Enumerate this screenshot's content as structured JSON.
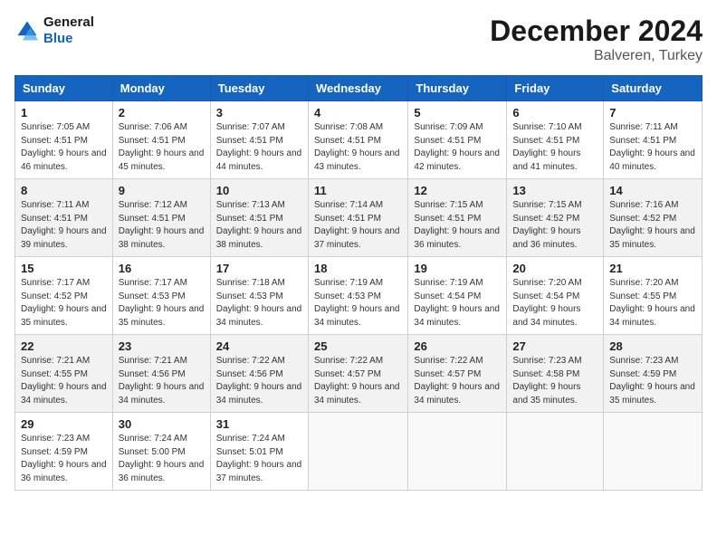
{
  "logo": {
    "line1": "General",
    "line2": "Blue"
  },
  "title": "December 2024",
  "location": "Balveren, Turkey",
  "headers": [
    "Sunday",
    "Monday",
    "Tuesday",
    "Wednesday",
    "Thursday",
    "Friday",
    "Saturday"
  ],
  "weeks": [
    [
      {
        "day": "1",
        "sunrise": "7:05 AM",
        "sunset": "4:51 PM",
        "daylight": "9 hours and 46 minutes."
      },
      {
        "day": "2",
        "sunrise": "7:06 AM",
        "sunset": "4:51 PM",
        "daylight": "9 hours and 45 minutes."
      },
      {
        "day": "3",
        "sunrise": "7:07 AM",
        "sunset": "4:51 PM",
        "daylight": "9 hours and 44 minutes."
      },
      {
        "day": "4",
        "sunrise": "7:08 AM",
        "sunset": "4:51 PM",
        "daylight": "9 hours and 43 minutes."
      },
      {
        "day": "5",
        "sunrise": "7:09 AM",
        "sunset": "4:51 PM",
        "daylight": "9 hours and 42 minutes."
      },
      {
        "day": "6",
        "sunrise": "7:10 AM",
        "sunset": "4:51 PM",
        "daylight": "9 hours and 41 minutes."
      },
      {
        "day": "7",
        "sunrise": "7:11 AM",
        "sunset": "4:51 PM",
        "daylight": "9 hours and 40 minutes."
      }
    ],
    [
      {
        "day": "8",
        "sunrise": "7:11 AM",
        "sunset": "4:51 PM",
        "daylight": "9 hours and 39 minutes."
      },
      {
        "day": "9",
        "sunrise": "7:12 AM",
        "sunset": "4:51 PM",
        "daylight": "9 hours and 38 minutes."
      },
      {
        "day": "10",
        "sunrise": "7:13 AM",
        "sunset": "4:51 PM",
        "daylight": "9 hours and 38 minutes."
      },
      {
        "day": "11",
        "sunrise": "7:14 AM",
        "sunset": "4:51 PM",
        "daylight": "9 hours and 37 minutes."
      },
      {
        "day": "12",
        "sunrise": "7:15 AM",
        "sunset": "4:51 PM",
        "daylight": "9 hours and 36 minutes."
      },
      {
        "day": "13",
        "sunrise": "7:15 AM",
        "sunset": "4:52 PM",
        "daylight": "9 hours and 36 minutes."
      },
      {
        "day": "14",
        "sunrise": "7:16 AM",
        "sunset": "4:52 PM",
        "daylight": "9 hours and 35 minutes."
      }
    ],
    [
      {
        "day": "15",
        "sunrise": "7:17 AM",
        "sunset": "4:52 PM",
        "daylight": "9 hours and 35 minutes."
      },
      {
        "day": "16",
        "sunrise": "7:17 AM",
        "sunset": "4:53 PM",
        "daylight": "9 hours and 35 minutes."
      },
      {
        "day": "17",
        "sunrise": "7:18 AM",
        "sunset": "4:53 PM",
        "daylight": "9 hours and 34 minutes."
      },
      {
        "day": "18",
        "sunrise": "7:19 AM",
        "sunset": "4:53 PM",
        "daylight": "9 hours and 34 minutes."
      },
      {
        "day": "19",
        "sunrise": "7:19 AM",
        "sunset": "4:54 PM",
        "daylight": "9 hours and 34 minutes."
      },
      {
        "day": "20",
        "sunrise": "7:20 AM",
        "sunset": "4:54 PM",
        "daylight": "9 hours and 34 minutes."
      },
      {
        "day": "21",
        "sunrise": "7:20 AM",
        "sunset": "4:55 PM",
        "daylight": "9 hours and 34 minutes."
      }
    ],
    [
      {
        "day": "22",
        "sunrise": "7:21 AM",
        "sunset": "4:55 PM",
        "daylight": "9 hours and 34 minutes."
      },
      {
        "day": "23",
        "sunrise": "7:21 AM",
        "sunset": "4:56 PM",
        "daylight": "9 hours and 34 minutes."
      },
      {
        "day": "24",
        "sunrise": "7:22 AM",
        "sunset": "4:56 PM",
        "daylight": "9 hours and 34 minutes."
      },
      {
        "day": "25",
        "sunrise": "7:22 AM",
        "sunset": "4:57 PM",
        "daylight": "9 hours and 34 minutes."
      },
      {
        "day": "26",
        "sunrise": "7:22 AM",
        "sunset": "4:57 PM",
        "daylight": "9 hours and 34 minutes."
      },
      {
        "day": "27",
        "sunrise": "7:23 AM",
        "sunset": "4:58 PM",
        "daylight": "9 hours and 35 minutes."
      },
      {
        "day": "28",
        "sunrise": "7:23 AM",
        "sunset": "4:59 PM",
        "daylight": "9 hours and 35 minutes."
      }
    ],
    [
      {
        "day": "29",
        "sunrise": "7:23 AM",
        "sunset": "4:59 PM",
        "daylight": "9 hours and 36 minutes."
      },
      {
        "day": "30",
        "sunrise": "7:24 AM",
        "sunset": "5:00 PM",
        "daylight": "9 hours and 36 minutes."
      },
      {
        "day": "31",
        "sunrise": "7:24 AM",
        "sunset": "5:01 PM",
        "daylight": "9 hours and 37 minutes."
      },
      null,
      null,
      null,
      null
    ]
  ]
}
